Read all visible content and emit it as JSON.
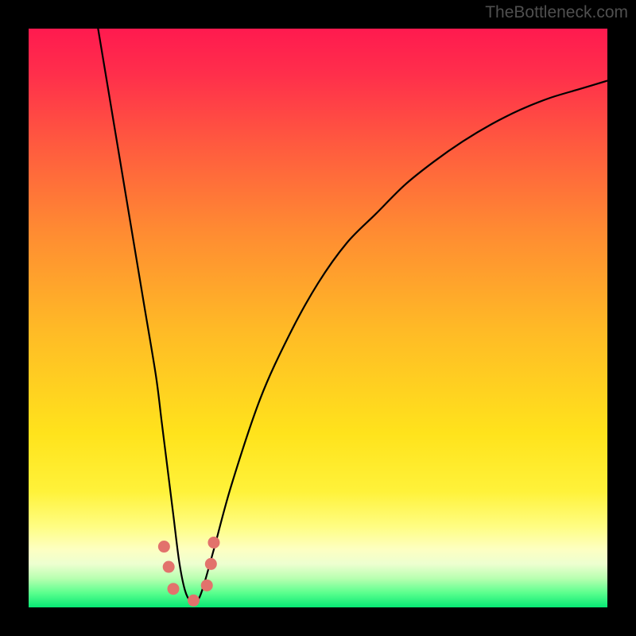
{
  "watermark": "TheBottleneck.com",
  "chart_data": {
    "type": "line",
    "title": "",
    "xlabel": "",
    "ylabel": "",
    "xlim": [
      0,
      100
    ],
    "ylim": [
      0,
      100
    ],
    "series": [
      {
        "name": "bottleneck-curve",
        "x": [
          12,
          14,
          16,
          18,
          20,
          22,
          23,
          24,
          25,
          26,
          27,
          28,
          29,
          30,
          32,
          35,
          40,
          45,
          50,
          55,
          60,
          65,
          70,
          75,
          80,
          85,
          90,
          95,
          100
        ],
        "values": [
          100,
          88,
          76,
          64,
          52,
          40,
          32,
          24,
          16,
          8,
          3,
          1,
          1,
          3,
          10,
          21,
          36,
          47,
          56,
          63,
          68,
          73,
          77,
          80.5,
          83.5,
          86,
          88,
          89.5,
          91
        ]
      }
    ],
    "markers": {
      "name": "optimal-range-markers",
      "color": "#e2726c",
      "points": [
        {
          "x": 23.4,
          "y": 10.5
        },
        {
          "x": 24.2,
          "y": 7.0
        },
        {
          "x": 25.0,
          "y": 3.2
        },
        {
          "x": 28.5,
          "y": 1.2
        },
        {
          "x": 30.8,
          "y": 3.8
        },
        {
          "x": 31.5,
          "y": 7.5
        },
        {
          "x": 32.0,
          "y": 11.2
        }
      ]
    },
    "gradient_stops": [
      {
        "pos": 0.0,
        "color": "#ff1a4f"
      },
      {
        "pos": 0.08,
        "color": "#ff2f4b"
      },
      {
        "pos": 0.2,
        "color": "#ff5a3f"
      },
      {
        "pos": 0.35,
        "color": "#ff8b32"
      },
      {
        "pos": 0.52,
        "color": "#ffba26"
      },
      {
        "pos": 0.7,
        "color": "#ffe31c"
      },
      {
        "pos": 0.8,
        "color": "#fff23a"
      },
      {
        "pos": 0.86,
        "color": "#fffd82"
      },
      {
        "pos": 0.9,
        "color": "#fdffc2"
      },
      {
        "pos": 0.925,
        "color": "#edffd0"
      },
      {
        "pos": 0.95,
        "color": "#b8ffb0"
      },
      {
        "pos": 0.975,
        "color": "#5bff8e"
      },
      {
        "pos": 1.0,
        "color": "#07e874"
      }
    ]
  }
}
